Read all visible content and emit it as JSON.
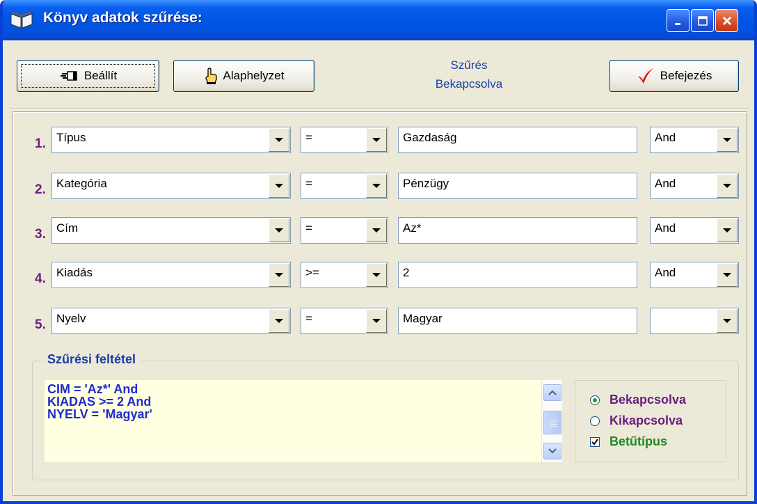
{
  "window": {
    "title": "Könyv adatok szűrése:"
  },
  "toolbar": {
    "set_label": "Beállít",
    "reset_label": "Alaphelyzet",
    "status_line1": "Szűrés",
    "status_line2": "Bekapcsolva",
    "done_label": "Befejezés"
  },
  "rows": [
    {
      "num": "1.",
      "field": "Típus",
      "op": "=",
      "value": "Gazdaság",
      "logic": "And"
    },
    {
      "num": "2.",
      "field": "Kategória",
      "op": "=",
      "value": "Pénzügy",
      "logic": "And"
    },
    {
      "num": "3.",
      "field": "Cím",
      "op": "=",
      "value": "Az*",
      "logic": "And"
    },
    {
      "num": "4.",
      "field": "Kiadás",
      "op": ">=",
      "value": "2",
      "logic": "And"
    },
    {
      "num": "5.",
      "field": "Nyelv",
      "op": "=",
      "value": "Magyar",
      "logic": ""
    }
  ],
  "condition": {
    "title": "Szűrési feltétel",
    "lines": [
      "CIM = 'Az*' And",
      "KIADAS >= 2 And",
      "NYELV = 'Magyar'"
    ]
  },
  "options": {
    "on_label": "Bekapcsolva",
    "off_label": "Kikapcsolva",
    "font_label": "Betűtípus",
    "on_selected": true,
    "font_checked": true
  },
  "colors": {
    "title_bar": "#0054e3",
    "status_text": "#1a3ea6",
    "row_number": "#6a1e7e",
    "condition_text": "#1f2ccf",
    "memo_background": "#ffffe1",
    "option_on": "#6a1e7e",
    "option_off": "#6a1e7e",
    "option_font": "#1e8a1e"
  }
}
